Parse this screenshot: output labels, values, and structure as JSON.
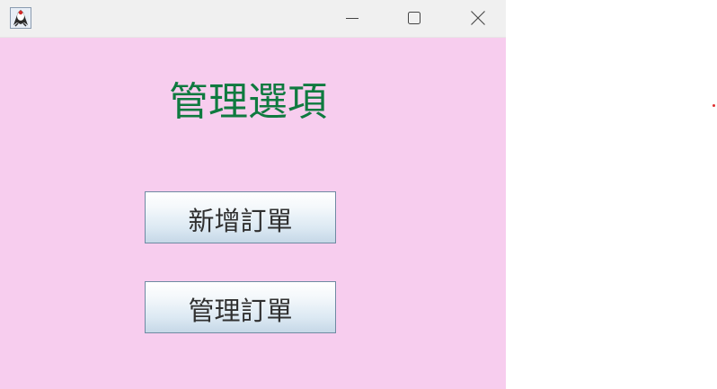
{
  "window": {
    "background": "#f7cdee",
    "titlebar": {
      "icon": "java-duke-icon",
      "controls": {
        "minimize_icon": "minimize-icon",
        "maximize_icon": "maximize-icon",
        "close_icon": "close-icon"
      }
    }
  },
  "main": {
    "title": "管理選項",
    "title_color": "#0f7a3f",
    "buttons": {
      "add_order_label": "新增訂單",
      "manage_order_label": "管理訂單"
    }
  }
}
